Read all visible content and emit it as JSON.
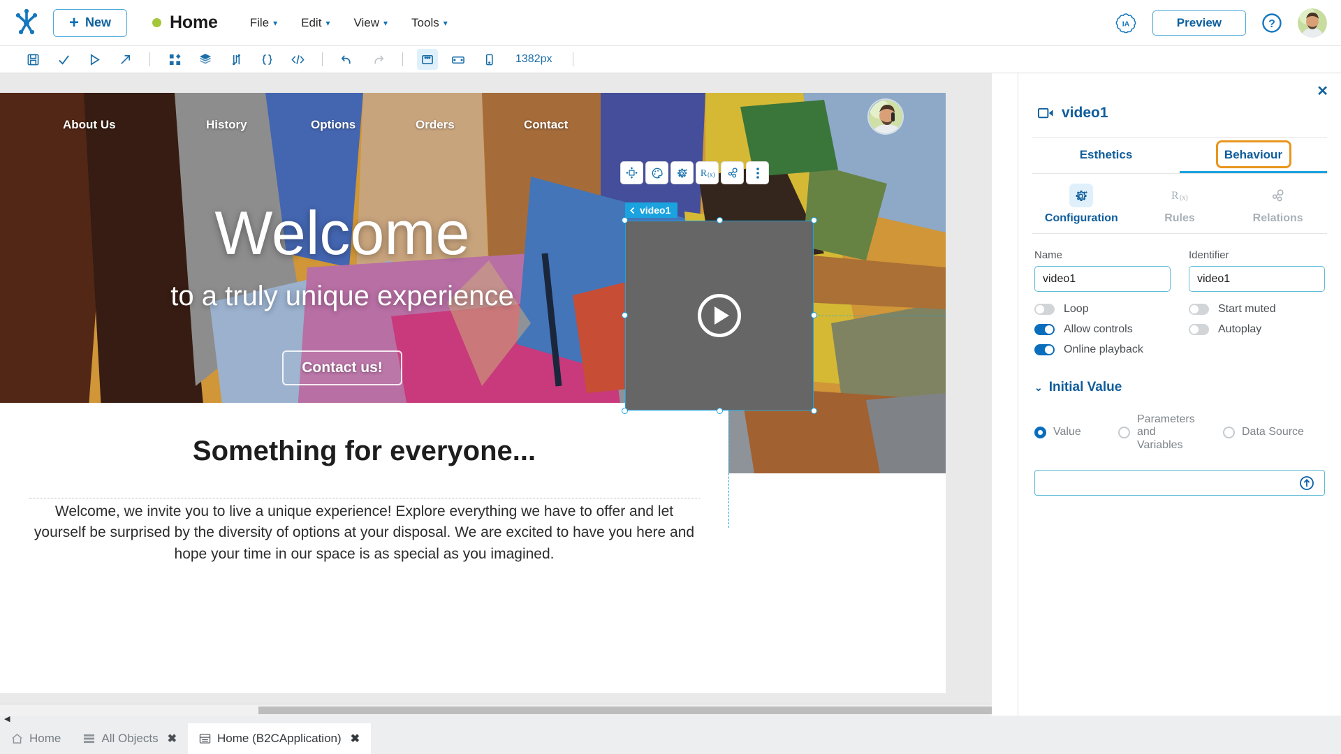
{
  "topbar": {
    "logo_icon": "genexus-logo-icon",
    "new_label": "New",
    "page_title": "Home",
    "menus": [
      {
        "label": "File"
      },
      {
        "label": "Edit"
      },
      {
        "label": "View"
      },
      {
        "label": "Tools"
      }
    ],
    "ia_label": "IA",
    "preview_label": "Preview",
    "help_icon": "question-circle-icon",
    "avatar_icon": "user-avatar"
  },
  "toolbar": {
    "icons": [
      {
        "name": "save-icon"
      },
      {
        "name": "check-icon"
      },
      {
        "name": "run-icon"
      },
      {
        "name": "deploy-icon"
      },
      {
        "name": "components-icon"
      },
      {
        "name": "layers-icon"
      },
      {
        "name": "variables-icon"
      },
      {
        "name": "braces-icon"
      },
      {
        "name": "code-icon"
      },
      {
        "name": "undo-icon"
      },
      {
        "name": "redo-icon"
      },
      {
        "name": "desktop-view-icon"
      },
      {
        "name": "tablet-view-icon"
      },
      {
        "name": "phone-view-icon"
      }
    ],
    "width_label": "1382px"
  },
  "canvas": {
    "hero": {
      "nav": [
        {
          "label": "About Us"
        },
        {
          "label": "History"
        },
        {
          "label": "Options"
        },
        {
          "label": "Orders"
        },
        {
          "label": "Contact"
        }
      ],
      "heading": "Welcome",
      "subheading": "to a truly unique experience",
      "cta_label": "Contact us!"
    },
    "section": {
      "heading": "Something for everyone...",
      "paragraph": "Welcome, we invite you to live a unique experience! Explore everything we have to offer and let yourself be surprised by the diversity of options at your disposal. We are excited to have you here and hope your time in our space is as special as you imagined."
    },
    "selection": {
      "badge_label": "video1",
      "float_toolbar": [
        {
          "name": "move-resize-icon"
        },
        {
          "name": "palette-icon"
        },
        {
          "name": "configuration-icon"
        },
        {
          "name": "rules-icon"
        },
        {
          "name": "relations-icon"
        },
        {
          "name": "more-options-icon"
        }
      ]
    }
  },
  "right_panel": {
    "close_icon": "close-icon",
    "header_icon": "video-icon",
    "header_title": "video1",
    "tabs": [
      {
        "label": "Esthetics",
        "selected": false
      },
      {
        "label": "Behaviour",
        "selected": true,
        "highlighted": true
      }
    ],
    "subtabs": [
      {
        "label": "Configuration",
        "icon": "configuration-icon",
        "selected": true
      },
      {
        "label": "Rules",
        "icon": "rules-icon",
        "selected": false
      },
      {
        "label": "Relations",
        "icon": "relations-icon",
        "selected": false
      }
    ],
    "fields": {
      "name_label": "Name",
      "name_value": "video1",
      "name_placeholder": "",
      "identifier_label": "Identifier",
      "identifier_value": "video1",
      "identifier_placeholder": ""
    },
    "toggles_left": [
      {
        "label": "Loop",
        "on": false
      },
      {
        "label": "Allow controls",
        "on": true
      },
      {
        "label": "Online playback",
        "on": true
      }
    ],
    "toggles_right": [
      {
        "label": "Start muted",
        "on": false
      },
      {
        "label": "Autoplay",
        "on": false
      }
    ],
    "initial_value": {
      "section_label": "Initial Value",
      "options": [
        {
          "label": "Value",
          "selected": true
        },
        {
          "label": "Parameters and Variables",
          "selected": false
        },
        {
          "label": "Data Source",
          "selected": false
        }
      ],
      "input_value": "",
      "input_placeholder": "",
      "upload_icon": "upload-circle-icon"
    }
  },
  "bottom_tabs": [
    {
      "label": "Home",
      "icon": "home-icon",
      "closable": false,
      "active": false
    },
    {
      "label": "All Objects",
      "icon": "list-icon",
      "closable": true,
      "active": false
    },
    {
      "label": "Home (B2CApplication)",
      "icon": "panel-icon",
      "closable": true,
      "active": true
    }
  ],
  "colors": {
    "brand_blue": "#0f5d9b",
    "accent_cyan": "#1ba3e0",
    "highlight_orange": "#e8961e",
    "toggle_on": "#0a6ebd",
    "status_dot_green": "#a4c639"
  }
}
